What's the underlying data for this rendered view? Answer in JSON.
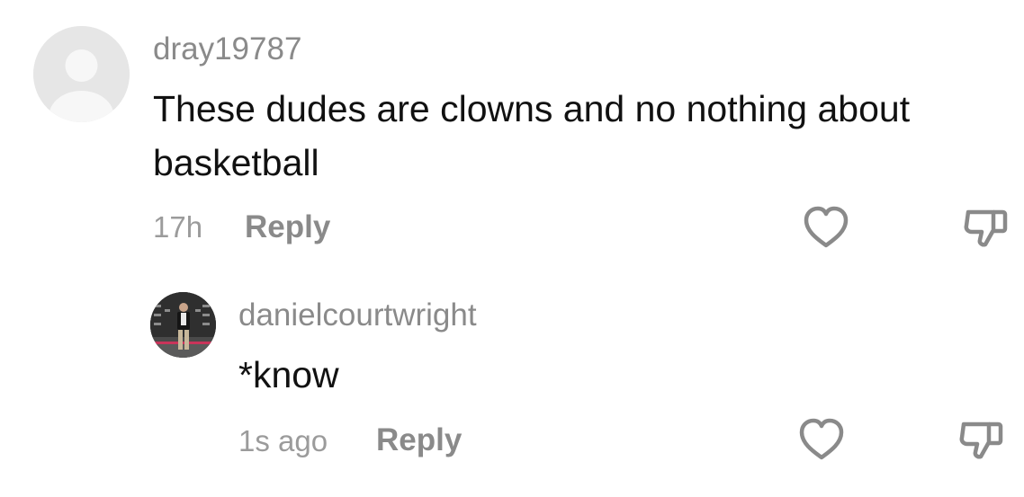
{
  "comment": {
    "username": "dray19787",
    "text": "These dudes are clowns and no nothing about basketball",
    "time": "17h",
    "reply_label": "Reply",
    "avatar": "default-avatar-icon",
    "like_icon": "heart-outline-icon",
    "dislike_icon": "thumbs-down-icon"
  },
  "reply": {
    "username": "danielcourtwright",
    "text": "*know",
    "time": "1s ago",
    "reply_label": "Reply",
    "avatar": "profile-photo",
    "like_icon": "heart-outline-icon",
    "dislike_icon": "thumbs-down-icon"
  },
  "colors": {
    "username": "#8a8a8a",
    "text": "#111111",
    "meta": "#9b9b9b",
    "icon": "#8a8a8a",
    "avatar_bg": "#e6e6e6"
  }
}
